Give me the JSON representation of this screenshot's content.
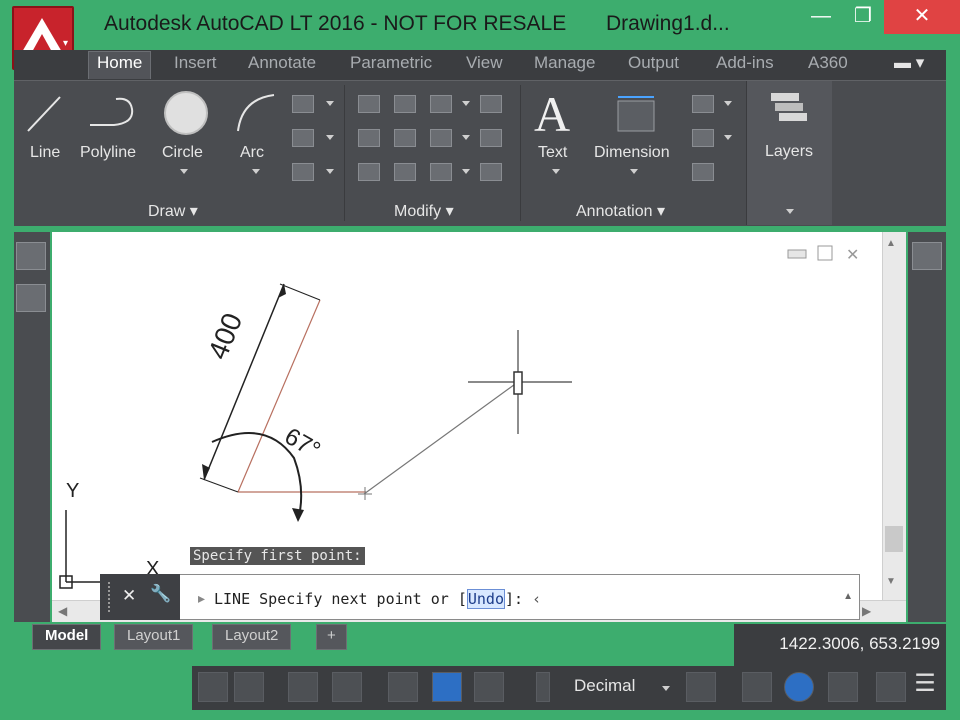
{
  "window": {
    "title": "Autodesk AutoCAD LT 2016 - NOT FOR RESALE",
    "document": "Drawing1.d...",
    "minimize": "—",
    "restore": "❐",
    "close": "✕"
  },
  "ribbon": {
    "tabs": [
      "Home",
      "Insert",
      "Annotate",
      "Parametric",
      "View",
      "Manage",
      "Output",
      "Add-ins",
      "A360"
    ],
    "active_tab": "Home",
    "draw": {
      "title": "Draw ▾",
      "buttons": [
        "Line",
        "Polyline",
        "Circle",
        "Arc"
      ]
    },
    "modify": {
      "title": "Modify ▾"
    },
    "annotation": {
      "title": "Annotation ▾",
      "buttons": [
        "Text",
        "Dimension"
      ]
    },
    "layers": {
      "label": "Layers"
    }
  },
  "drawing": {
    "dimension_length": "400",
    "angle": "67°",
    "ucs_x": "X",
    "ucs_y": "Y"
  },
  "command": {
    "prompt_history": "Specify first point:",
    "current": "LINE Specify next point or [",
    "option": "Undo",
    "current_end": "]: ",
    "close_icon": "✕",
    "settings_icon": "🔧"
  },
  "layout_tabs": [
    "Model",
    "Layout1",
    "Layout2"
  ],
  "add_layout": "+",
  "status": {
    "coordinates": "1422.3006, 653.2199",
    "units": "Decimal"
  },
  "colors": {
    "accent": "#3dad6e",
    "ribbon": "#4a4c50",
    "close": "#e04343"
  }
}
